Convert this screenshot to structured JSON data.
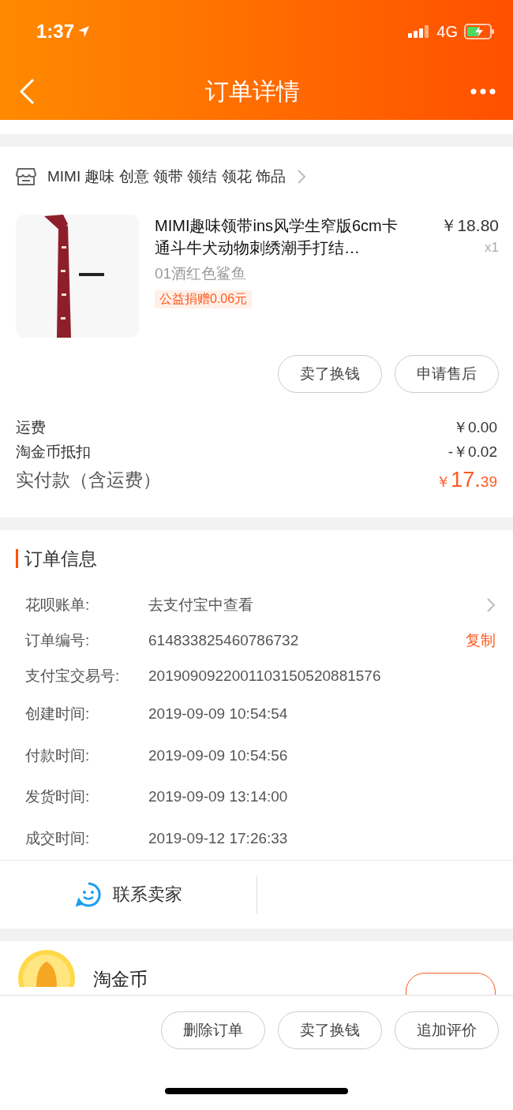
{
  "status_bar": {
    "time": "1:37",
    "network": "4G"
  },
  "nav": {
    "title": "订单详情"
  },
  "shop": {
    "name": "MIMI 趣味 创意 领带 领结 领花 饰品"
  },
  "item": {
    "title": "MIMI趣味领带ins风学生窄版6cm卡通斗牛犬动物刺绣潮手打结…",
    "price": "￥18.80",
    "quantity": "x1",
    "variant": "01酒红色鲨鱼",
    "charity_tag": "公益捐赠0.06元"
  },
  "item_actions": [
    "卖了换钱",
    "申请售后"
  ],
  "costs": [
    {
      "label": "运费",
      "value": "￥0.00"
    },
    {
      "label": "淘金币抵扣",
      "value": "-￥0.02"
    }
  ],
  "total": {
    "label": "实付款（含运费）",
    "currency": "￥",
    "integer": "17.",
    "decimal": "39"
  },
  "order_info": {
    "title": "订单信息",
    "rows": [
      {
        "label": "花呗账单:",
        "value": "去支付宝中查看",
        "kind": "link"
      },
      {
        "label": "订单编号:",
        "value": "614833825460786732",
        "kind": "copy",
        "action": "复制"
      },
      {
        "label": "支付宝交易号:",
        "value": "2019090922001103150520881576",
        "kind": "plain"
      },
      {
        "label": "创建时间:",
        "value": "2019-09-09 10:54:54",
        "kind": "plain"
      },
      {
        "label": "付款时间:",
        "value": "2019-09-09 10:54:56",
        "kind": "plain"
      },
      {
        "label": "发货时间:",
        "value": "2019-09-09 13:14:00",
        "kind": "plain"
      },
      {
        "label": "成交时间:",
        "value": "2019-09-12 17:26:33",
        "kind": "plain"
      }
    ]
  },
  "contact": {
    "label": "联系卖家"
  },
  "coins": {
    "title": "淘金币"
  },
  "bottom_actions": [
    "删除订单",
    "卖了换钱",
    "追加评价"
  ]
}
